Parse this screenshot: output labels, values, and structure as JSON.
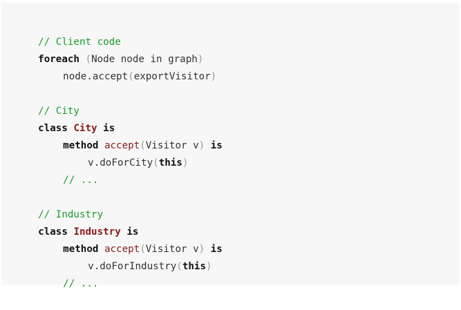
{
  "code": {
    "client_comment": "// Client code",
    "foreach_kw": "foreach",
    "lparen": "(",
    "rparen": ")",
    "foreach_args": "Node node in graph",
    "node_accept_call": "node.accept",
    "export_visitor": "exportVisitor",
    "city_comment": "// City",
    "class_kw": "class",
    "city_name": "City",
    "is_kw": "is",
    "method_kw": "method",
    "accept_name": "accept",
    "visitor_param": "Visitor v",
    "do_for_city": "v.doForCity",
    "this_kw": "this",
    "ellipsis_comment": "// ...",
    "industry_comment": "// Industry",
    "industry_name": "Industry",
    "do_for_industry": "v.doForIndustry"
  }
}
